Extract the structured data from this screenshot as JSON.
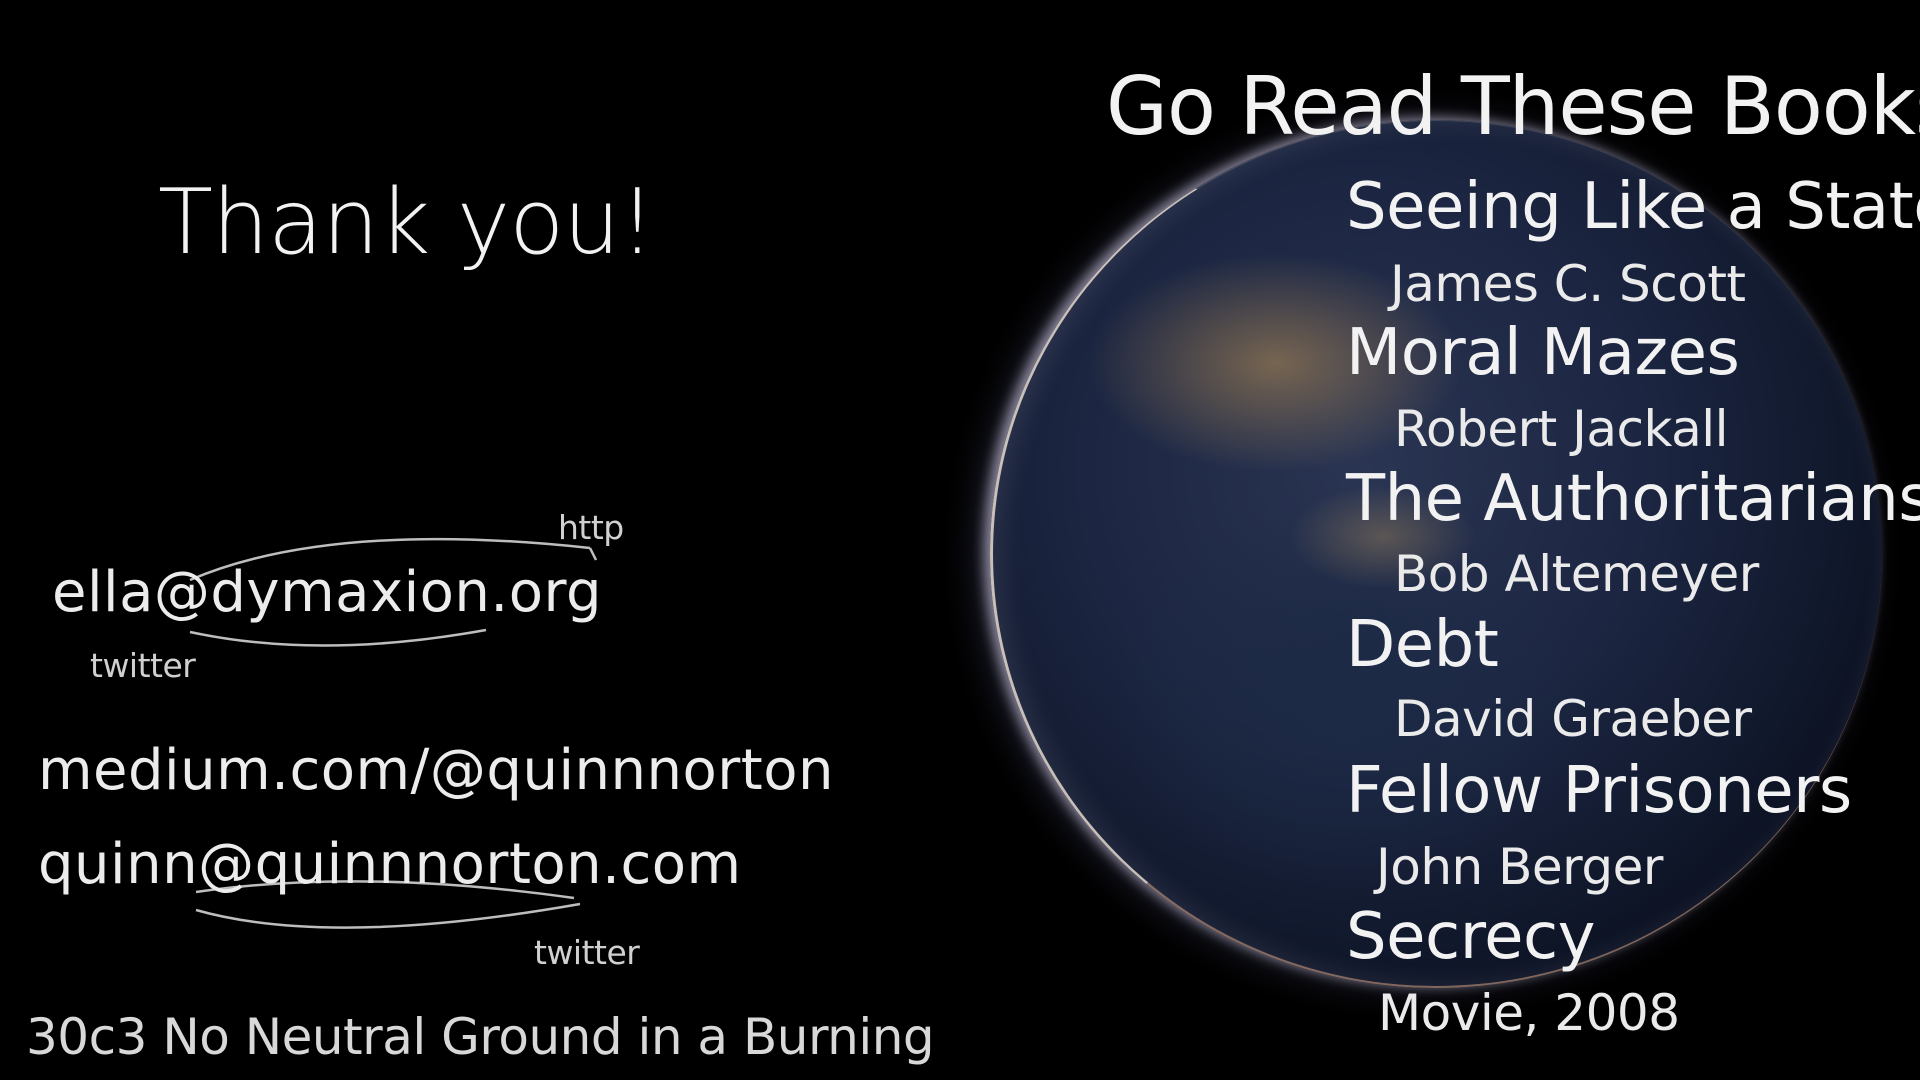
{
  "thank_you": "Thank you!",
  "contacts": {
    "email_ella": "ella@dymaxion.org",
    "note_http": "http",
    "note_twitter_1": "twitter",
    "medium_url": "medium.com/@quinnnorton",
    "email_quinn": "quinn@quinnnorton.com",
    "note_twitter_2": "twitter"
  },
  "footer": "30c3   No Neutral Ground in a Burning",
  "books": {
    "heading": "Go Read These Books:",
    "items": [
      {
        "title": "Seeing Like a State",
        "author": "James C. Scott"
      },
      {
        "title": "Moral Mazes",
        "author": "Robert Jackall"
      },
      {
        "title": "The Authoritarians",
        "author": "Bob Altemeyer"
      },
      {
        "title": "Debt",
        "author": "David Graeber"
      },
      {
        "title": "Fellow Prisoners",
        "author": "John Berger"
      },
      {
        "title": "Secrecy",
        "author": "Movie, 2008"
      }
    ]
  },
  "colors": {
    "background": "#000000",
    "text": "#ececec",
    "earth_dark": "#121a2f",
    "city_lights": "#ffbe5a"
  }
}
